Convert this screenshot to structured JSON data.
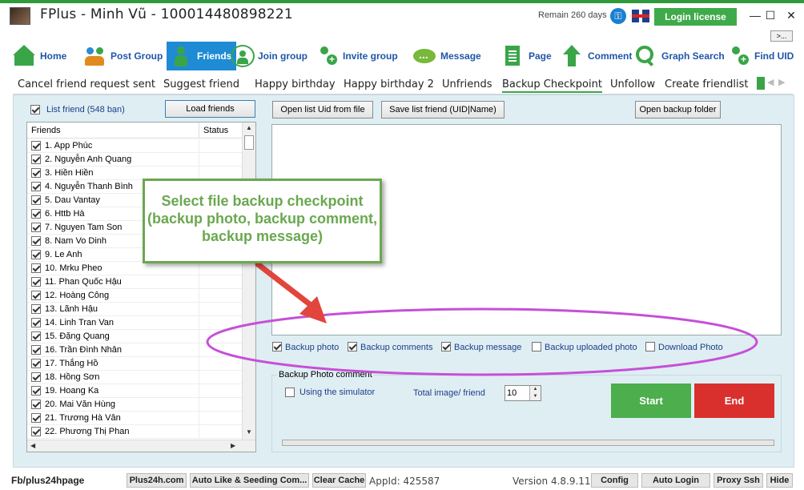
{
  "window": {
    "title": "FPlus - Minh Vũ - 100014480898221",
    "remain": "Remain 260 days",
    "login_button": "Login license",
    "minimize": "—",
    "maximize": "☐",
    "close": "✕",
    "more": ">..."
  },
  "main_menu": [
    {
      "label": "Home",
      "icon": "home-icon"
    },
    {
      "label": "Post Group",
      "icon": "people-icon"
    },
    {
      "label": "Friends",
      "icon": "person-icon",
      "active": true
    },
    {
      "label": "Join group",
      "icon": "group-icon"
    },
    {
      "label": "Invite group",
      "icon": "add-user-icon"
    },
    {
      "label": "Message",
      "icon": "chat-icon"
    },
    {
      "label": "Page",
      "icon": "page-icon"
    },
    {
      "label": "Comment",
      "icon": "arrow-up-icon"
    },
    {
      "label": "Graph Search",
      "icon": "search-icon"
    },
    {
      "label": "Find UID",
      "icon": "add-user-icon"
    }
  ],
  "sub_tabs": [
    {
      "label": "Cancel friend request sent"
    },
    {
      "label": "Suggest friend"
    },
    {
      "label": "Happy birthday"
    },
    {
      "label": "Happy birthday 2"
    },
    {
      "label": "Unfriends"
    },
    {
      "label": "Backup Checkpoint",
      "active": true
    },
    {
      "label": "Unfollow"
    },
    {
      "label": "Create friendlist"
    }
  ],
  "left_panel": {
    "list_friend_label": "List friend (548 bạn)",
    "list_friend_checked": true,
    "load_friends_button": "Load friends",
    "columns": [
      "Friends",
      "Status"
    ],
    "friends": [
      "1. App Phúc",
      "2. Nguyễn Anh Quang",
      "3. Hiền Hiền",
      "4. Nguyễn Thanh Bình",
      "5. Dau Vantay",
      "6. Httb Hà",
      "7. Nguyen Tam Son",
      "8. Nam Vo Dinh",
      "9. Le Anh",
      "10. Mrku Pheo",
      "11. Phan Quốc Hậu",
      "12. Hoàng Công",
      "13. Lãnh Hậu",
      "14. Linh Tran Van",
      "15. Đặng Quang",
      "16. Trần Đình Nhân",
      "17. Thắng Hồ",
      "18. Hồng Sơn",
      "19. Hoang Ka",
      "20. Mai Văn Hùng",
      "21. Trương Hà Vân",
      "22. Phương Thị Phan"
    ]
  },
  "right_panel": {
    "open_list_button": "Open list Uid from file",
    "save_list_button": "Save list friend (UID|Name)",
    "open_backup_button": "Open backup folder",
    "options": [
      {
        "label": "Backup photo",
        "checked": true
      },
      {
        "label": "Backup comments",
        "checked": true
      },
      {
        "label": "Backup message",
        "checked": true
      },
      {
        "label": "Backup uploaded photo",
        "checked": false
      },
      {
        "label": "Download Photo",
        "checked": false
      }
    ],
    "backup_photo_group": "Backup Photo  comment",
    "simulator_label": "Using the simulator",
    "simulator_checked": false,
    "total_label": "Total image/ friend",
    "total_value": "10",
    "start_button": "Start",
    "end_button": "End",
    "progress": 0
  },
  "callout": {
    "text": "Select file backup checkpoint (backup photo, backup comment, backup message)"
  },
  "status_bar": {
    "page": "Fb/plus24hpage",
    "buttons": [
      "Plus24h.com",
      "Auto Like & Seeding Com...",
      "Clear Cache"
    ],
    "appid": "AppId: 425587",
    "version": "Version 4.8.9.11",
    "right_buttons": [
      "Config",
      "Auto Login",
      "Proxy Ssh",
      "Hide"
    ]
  },
  "colors": {
    "accent_green": "#3aa548",
    "active_menu_blue": "#1e8bd4",
    "start_green": "#4cae4c",
    "end_red": "#d9302e",
    "annotation_arrow": "#e2453c",
    "annotation_ellipse": "#c64fd8"
  }
}
